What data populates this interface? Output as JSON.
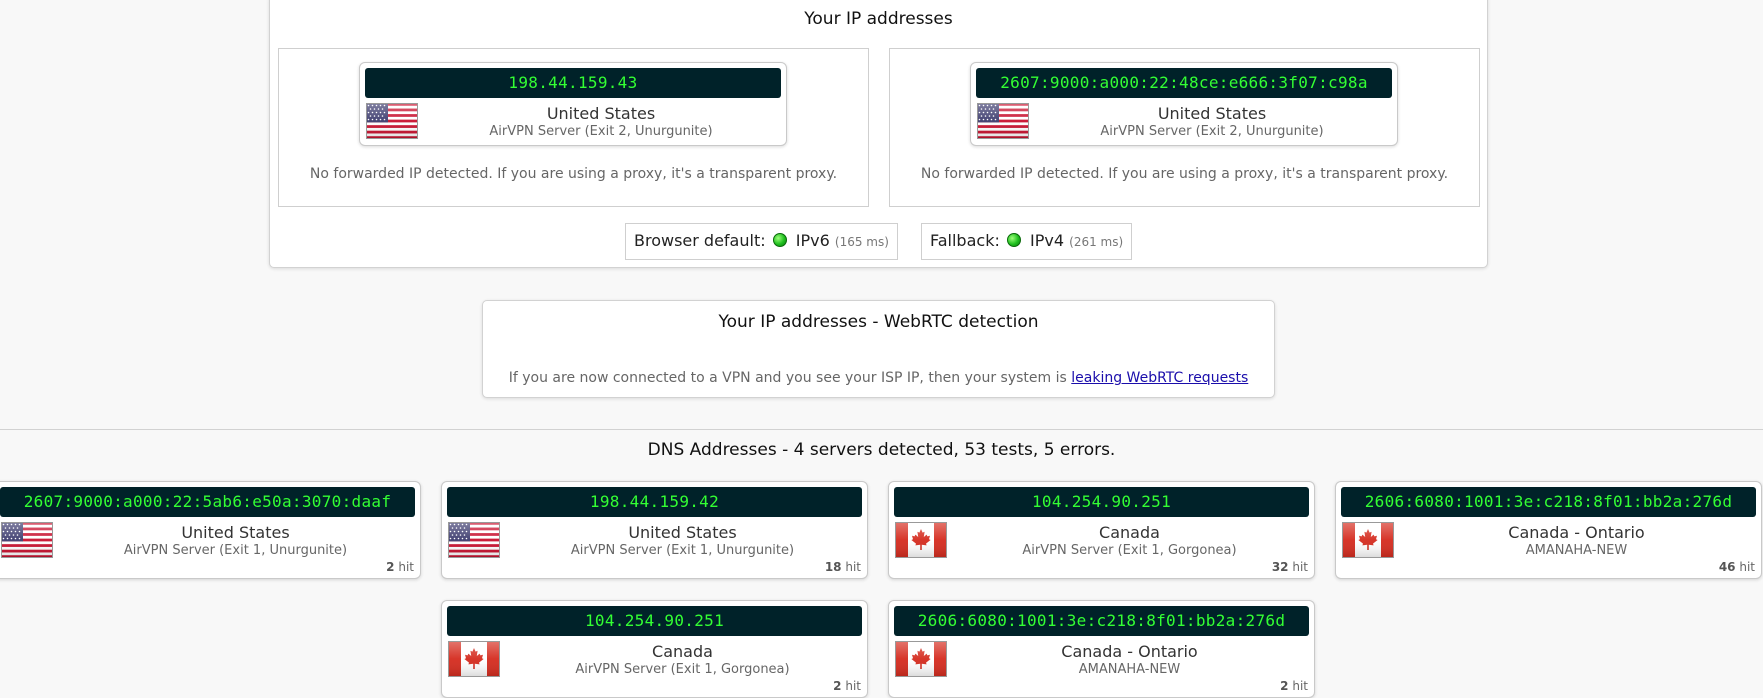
{
  "ip_panel": {
    "title": "Your IP addresses",
    "cards": [
      {
        "ip": "198.44.159.43",
        "country": "United States",
        "server": "AirVPN Server (Exit 2, Unurgunite)",
        "flag": "us-flag-icon",
        "note": "No forwarded IP detected. If you are using a proxy, it's a transparent proxy."
      },
      {
        "ip": "2607:9000:a000:22:48ce:e666:3f07:c98a",
        "country": "United States",
        "server": "AirVPN Server (Exit 2, Unurgunite)",
        "flag": "us-flag-icon",
        "note": "No forwarded IP detected. If you are using a proxy, it's a transparent proxy."
      }
    ],
    "browser_default": {
      "label": "Browser default:",
      "proto": "IPv6",
      "ms": "(165 ms)"
    },
    "fallback": {
      "label": "Fallback:",
      "proto": "IPv4",
      "ms": "(261 ms)"
    }
  },
  "webrtc_panel": {
    "title": "Your IP addresses - WebRTC detection",
    "note": "If you are now connected to a VPN and you see your ISP IP, then your system is",
    "link": "leaking WebRTC requests"
  },
  "dns_panel": {
    "title": "DNS Addresses - 4 servers detected, 53 tests, 5 errors.",
    "cards": [
      {
        "ip": "2607:9000:a000:22:5ab6:e50a:3070:daaf",
        "country": "United States",
        "server": "AirVPN Server (Exit 1, Unurgunite)",
        "hits": "2",
        "flag": "us-flag-icon"
      },
      {
        "ip": "198.44.159.42",
        "country": "United States",
        "server": "AirVPN Server (Exit 1, Unurgunite)",
        "hits": "18",
        "flag": "us-flag-icon"
      },
      {
        "ip": "104.254.90.251",
        "country": "Canada",
        "server": "AirVPN Server (Exit 1, Gorgonea)",
        "hits": "32",
        "flag": "ca-flag-icon"
      },
      {
        "ip": "2606:6080:1001:3e:c218:8f01:bb2a:276d",
        "country": "Canada - Ontario",
        "server": "AMANAHA-NEW",
        "hits": "46",
        "flag": "ca-flag-icon"
      },
      {
        "ip": "104.254.90.251",
        "country": "Canada",
        "server": "AirVPN Server (Exit 1, Gorgonea)",
        "hits": "2",
        "flag": "ca-flag-icon"
      },
      {
        "ip": "2606:6080:1001:3e:c218:8f01:bb2a:276d",
        "country": "Canada - Ontario",
        "server": "AMANAHA-NEW",
        "hits": "2",
        "flag": "ca-flag-icon"
      }
    ],
    "hit_suffix": "hit"
  },
  "colors": {
    "ip_bar_bg": "#002229",
    "ip_text": "#33ff33",
    "status_ok": "#1fbf1f",
    "link": "#1a0dab"
  }
}
